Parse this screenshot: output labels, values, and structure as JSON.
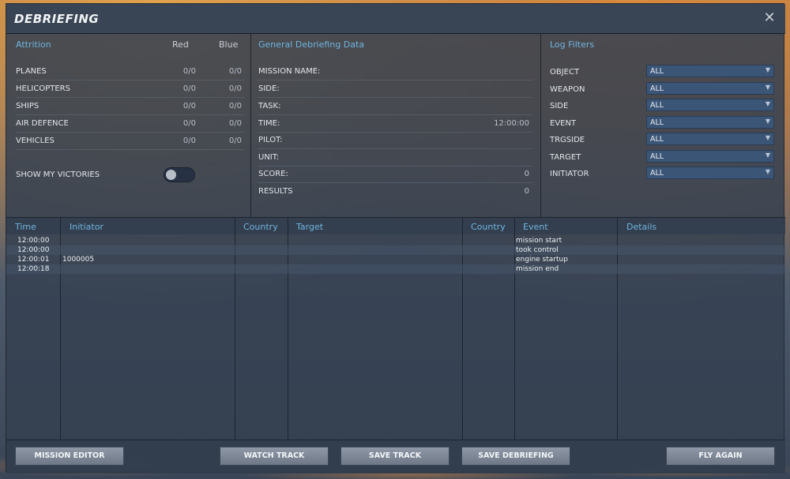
{
  "window": {
    "title": "DEBRIEFING",
    "close_glyph": "✕"
  },
  "attrition": {
    "heading": "Attrition",
    "col_red": "Red",
    "col_blue": "Blue",
    "rows": [
      {
        "label": "PLANES",
        "red": "0/0",
        "blue": "0/0"
      },
      {
        "label": "HELICOPTERS",
        "red": "0/0",
        "blue": "0/0"
      },
      {
        "label": "SHIPS",
        "red": "0/0",
        "blue": "0/0"
      },
      {
        "label": "AIR DEFENCE",
        "red": "0/0",
        "blue": "0/0"
      },
      {
        "label": "VEHICLES",
        "red": "0/0",
        "blue": "0/0"
      }
    ],
    "victories_label": "SHOW MY VICTORIES",
    "victories_on": false
  },
  "general": {
    "heading": "General Debriefing Data",
    "rows": [
      {
        "label": "MISSION NAME:",
        "value": ""
      },
      {
        "label": "SIDE:",
        "value": ""
      },
      {
        "label": "TASK:",
        "value": ""
      },
      {
        "label": "TIME:",
        "value": "12:00:00"
      },
      {
        "label": "PILOT:",
        "value": ""
      },
      {
        "label": "UNIT:",
        "value": ""
      },
      {
        "label": "SCORE:",
        "value": "0"
      },
      {
        "label": "RESULTS",
        "value": "0"
      }
    ]
  },
  "filters": {
    "heading": "Log Filters",
    "rows": [
      {
        "label": "OBJECT",
        "value": "ALL"
      },
      {
        "label": "WEAPON",
        "value": "ALL"
      },
      {
        "label": "SIDE",
        "value": "ALL"
      },
      {
        "label": "EVENT",
        "value": "ALL"
      },
      {
        "label": "TRGSIDE",
        "value": "ALL"
      },
      {
        "label": "TARGET",
        "value": "ALL"
      },
      {
        "label": "INITIATOR",
        "value": "ALL"
      }
    ]
  },
  "log": {
    "columns": [
      "Time",
      "Initiator",
      "Country",
      "Target",
      "Country",
      "Event",
      "Details"
    ],
    "rows": [
      {
        "time": "12:00:00",
        "initiator": "",
        "country": "",
        "target": "",
        "target_country": "",
        "event": "mission start",
        "details": ""
      },
      {
        "time": "12:00:00",
        "initiator": "",
        "country": "",
        "target": "",
        "target_country": "",
        "event": "took control",
        "details": ""
      },
      {
        "time": "12:00:01",
        "initiator": "1000005",
        "country": "",
        "target": "",
        "target_country": "",
        "event": "engine startup",
        "details": ""
      },
      {
        "time": "12:00:18",
        "initiator": "",
        "country": "",
        "target": "",
        "target_country": "",
        "event": "mission end",
        "details": ""
      }
    ]
  },
  "footer": {
    "mission_editor": "MISSION EDITOR",
    "watch_track": "WATCH TRACK",
    "save_track": "SAVE TRACK",
    "save_debriefing": "SAVE DEBRIEFING",
    "fly_again": "FLY AGAIN"
  },
  "colors": {
    "accent_heading": "#6fb4e0",
    "panel": "#344050",
    "select_bg": "#3b5577",
    "button": "#7e8897"
  }
}
